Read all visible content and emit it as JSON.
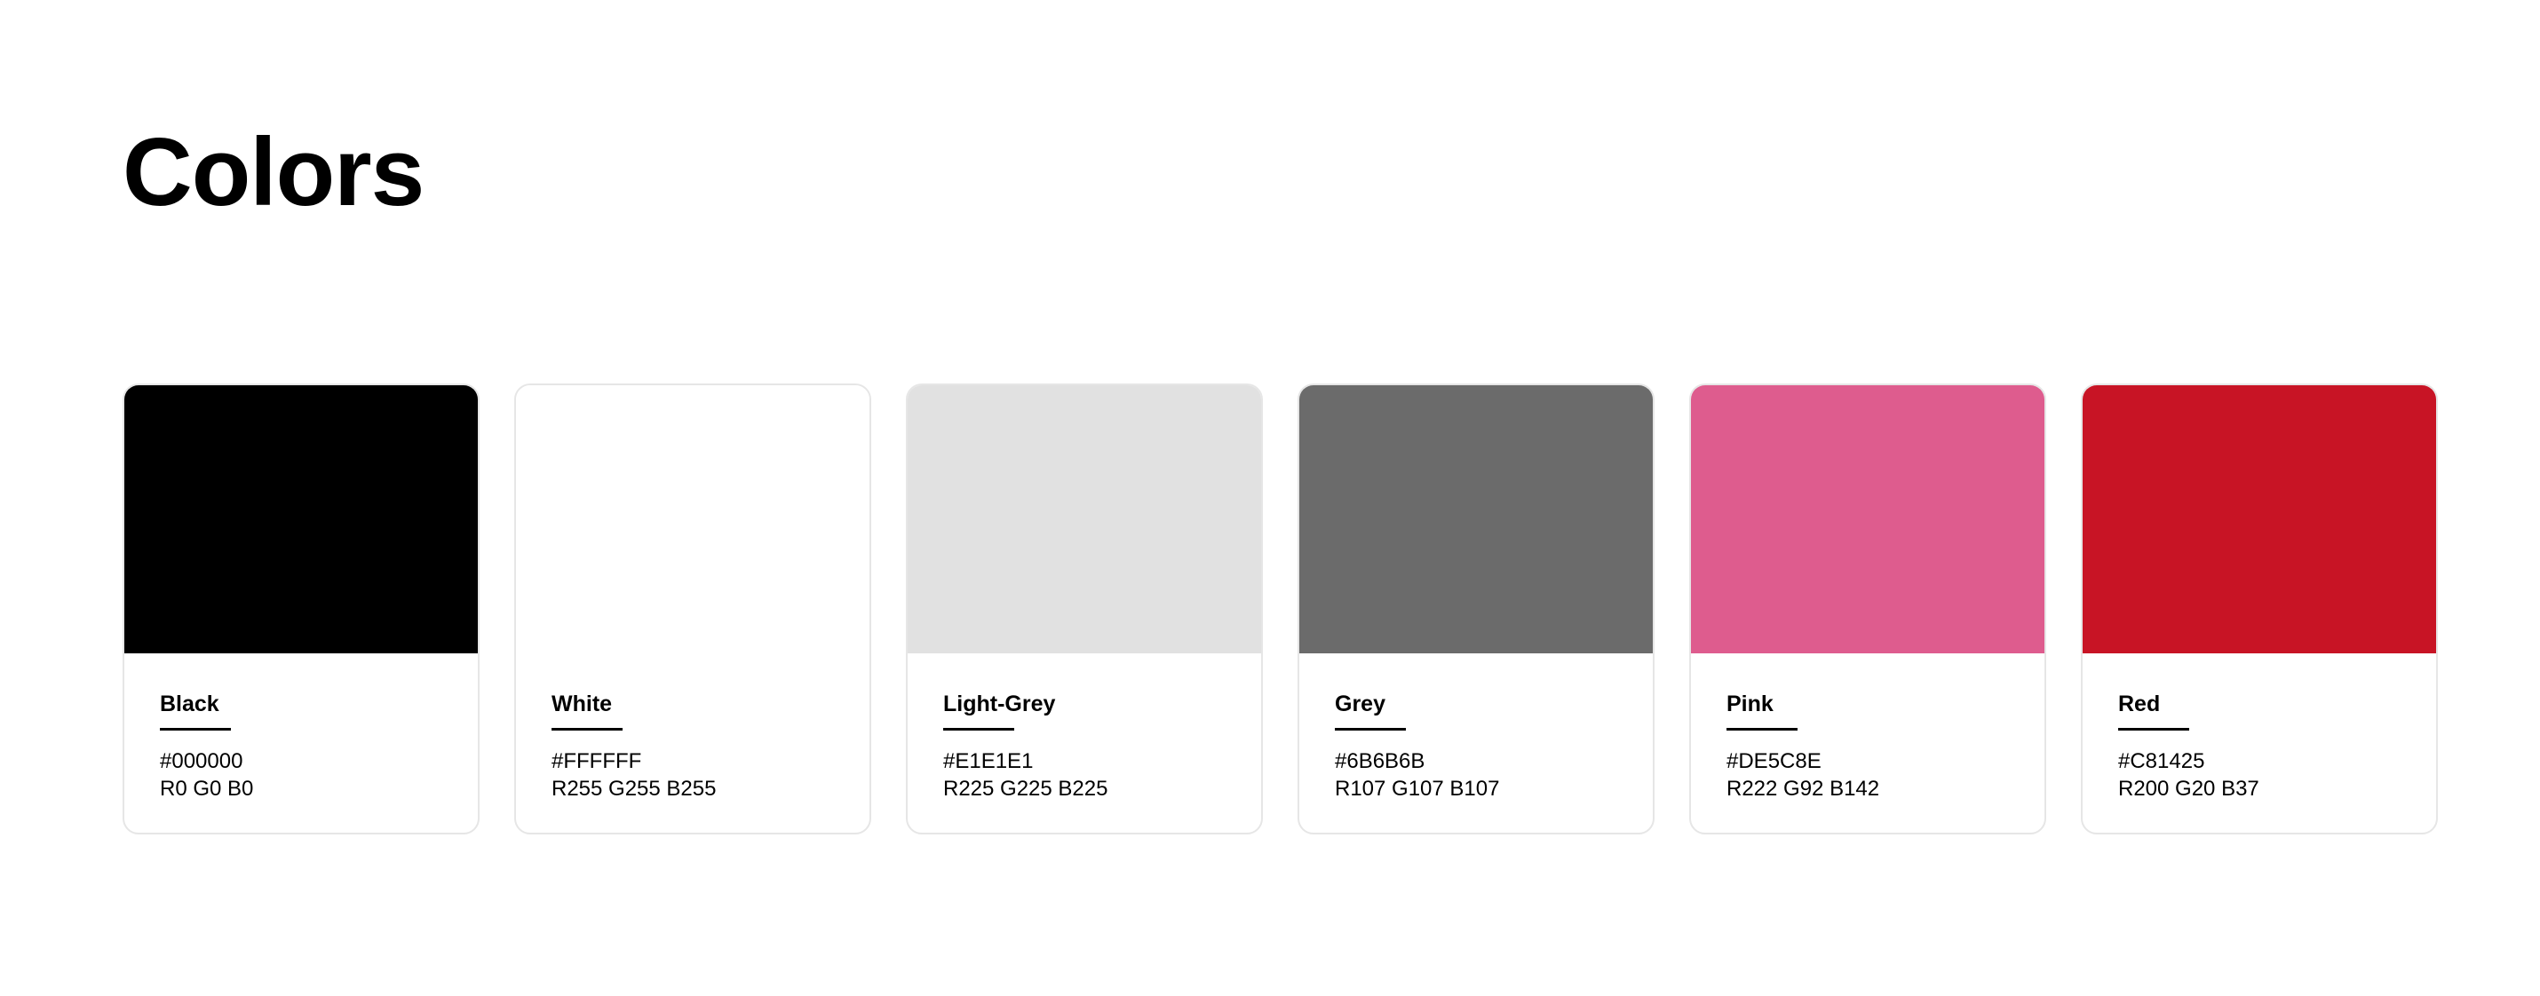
{
  "title": "Colors",
  "swatches": [
    {
      "name": "Black",
      "hex": "#000000",
      "rgb": "R0 G0 B0",
      "color": "#000000"
    },
    {
      "name": "White",
      "hex": "#FFFFFF",
      "rgb": "R255 G255 B255",
      "color": "#FFFFFF"
    },
    {
      "name": "Light-Grey",
      "hex": "#E1E1E1",
      "rgb": "R225 G225 B225",
      "color": "#E1E1E1"
    },
    {
      "name": "Grey",
      "hex": "#6B6B6B",
      "rgb": "R107 G107 B107",
      "color": "#6B6B6B"
    },
    {
      "name": "Pink",
      "hex": "#DE5C8E",
      "rgb": "R222 G92 B142",
      "color": "#DE5C8E"
    },
    {
      "name": "Red",
      "hex": "#C81425",
      "rgb": "R200 G20 B37",
      "color": "#C81425"
    }
  ]
}
